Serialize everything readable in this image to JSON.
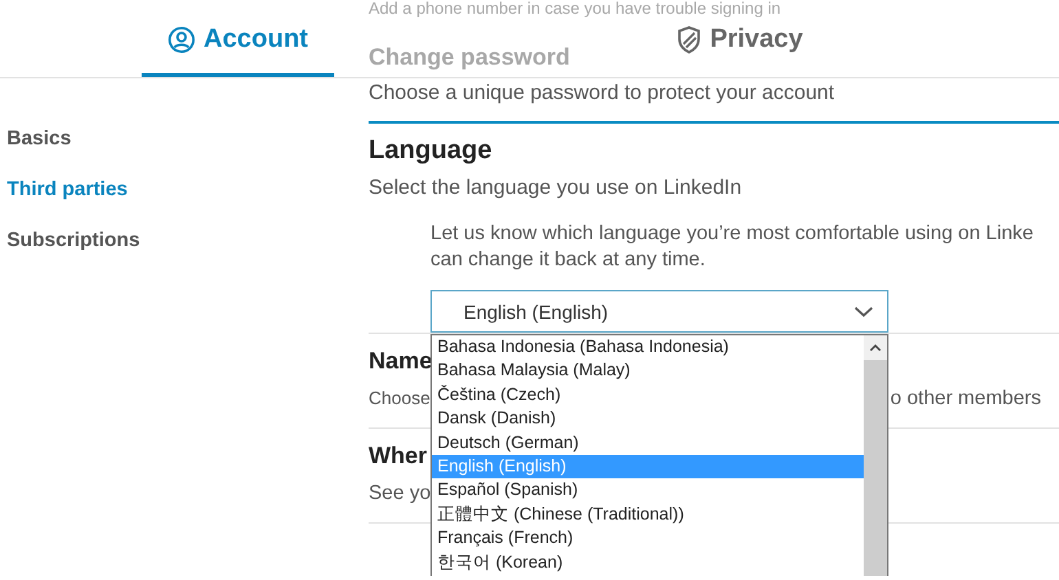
{
  "tabs": [
    {
      "label": "Account",
      "selected": true
    },
    {
      "label": "Privacy",
      "selected": false
    }
  ],
  "sidebar": {
    "items": [
      {
        "label": "Basics",
        "selected": false
      },
      {
        "label": "Third parties",
        "selected": true
      },
      {
        "label": "Subscriptions",
        "selected": false
      }
    ]
  },
  "phone_hint": "Add a phone number in case you have trouble signing in",
  "change_password": {
    "heading": "Change password",
    "description": "Choose a unique password to protect your account"
  },
  "language": {
    "heading": "Language",
    "description": "Select the language you use on LinkedIn",
    "help_lines": [
      "Let us know which language you’re most comfortable using on Linke",
      "can change it back at any time."
    ],
    "select": {
      "value": "English (English)",
      "expanded": true,
      "options": [
        {
          "label": "Bahasa Indonesia (Bahasa Indonesia)",
          "selected": false
        },
        {
          "label": "Bahasa Malaysia (Malay)",
          "selected": false
        },
        {
          "label": "Čeština (Czech)",
          "selected": false
        },
        {
          "label": "Dansk (Danish)",
          "selected": false
        },
        {
          "label": "Deutsch (German)",
          "selected": false
        },
        {
          "label": "English (English)",
          "selected": true
        },
        {
          "label": "Español (Spanish)",
          "selected": false
        },
        {
          "label": "正體中文 (Chinese (Traditional))",
          "selected": false
        },
        {
          "label": "Français (French)",
          "selected": false
        },
        {
          "label": "한국어 (Korean)",
          "selected": false
        }
      ]
    }
  },
  "sections": [
    {
      "heading": "Name",
      "description_start": "Choose",
      "description_end": "o other members"
    },
    {
      "heading": "Wher",
      "description_start": "See yo"
    }
  ]
}
